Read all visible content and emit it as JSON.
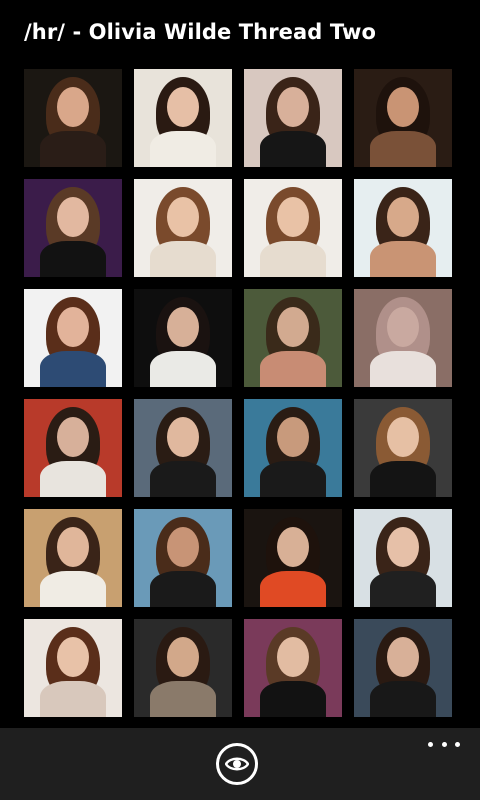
{
  "header": {
    "title": "/hr/ - Olivia Wilde Thread Two"
  },
  "thumbnails": [
    {
      "bg": "#1b1712",
      "hair": "#4a2c1a",
      "skin": "#d9a78a",
      "cloth": "#2a1d17"
    },
    {
      "bg": "#e8e3da",
      "hair": "#2a1a12",
      "skin": "#e6bfa6",
      "cloth": "#f0ece4"
    },
    {
      "bg": "#d8c8c0",
      "hair": "#3a2418",
      "skin": "#d8b09a",
      "cloth": "#161616"
    },
    {
      "bg": "#2a1c14",
      "hair": "#1e120c",
      "skin": "#c99474",
      "cloth": "#7a5138"
    },
    {
      "bg": "#3b1c4a",
      "hair": "#5a3a26",
      "skin": "#e2b8a0",
      "cloth": "#121212"
    },
    {
      "bg": "#f0ede8",
      "hair": "#7a4a2c",
      "skin": "#e9c2a6",
      "cloth": "#e6dccf"
    },
    {
      "bg": "#f0ede8",
      "hair": "#7a4a2c",
      "skin": "#e9c2a6",
      "cloth": "#e6dccf"
    },
    {
      "bg": "#e6eef0",
      "hair": "#3a2418",
      "skin": "#d7a98a",
      "cloth": "#c99474"
    },
    {
      "bg": "#f2f2f2",
      "hair": "#5a2e1a",
      "skin": "#e2b39a",
      "cloth": "#2d4b74"
    },
    {
      "bg": "#0e0e0e",
      "hair": "#1a1210",
      "skin": "#d7b098",
      "cloth": "#eaeae6"
    },
    {
      "bg": "#4c5a3a",
      "hair": "#3a2a1a",
      "skin": "#d2aa90",
      "cloth": "#c88c74"
    },
    {
      "bg": "#8a6e66",
      "hair": "#b0908a",
      "skin": "#c9a9a0",
      "cloth": "#e8e0dc"
    },
    {
      "bg": "#b83a2a",
      "hair": "#2a1c14",
      "skin": "#d7b09a",
      "cloth": "#e8e4de"
    },
    {
      "bg": "#5a6a7a",
      "hair": "#2a1c14",
      "skin": "#e0b89e",
      "cloth": "#1a1a1a"
    },
    {
      "bg": "#3a7a9a",
      "hair": "#2a1c14",
      "skin": "#c89a7c",
      "cloth": "#1a1a1a"
    },
    {
      "bg": "#3a3a3a",
      "hair": "#8a5a34",
      "skin": "#e6c0a4",
      "cloth": "#141414"
    },
    {
      "bg": "#c8a070",
      "hair": "#3a2418",
      "skin": "#e0b69a",
      "cloth": "#f0ece4"
    },
    {
      "bg": "#6a9ab8",
      "hair": "#4a2c1a",
      "skin": "#c89476",
      "cloth": "#1a1a1a"
    },
    {
      "bg": "#1a1410",
      "hair": "#1e120c",
      "skin": "#d8b096",
      "cloth": "#e04a24"
    },
    {
      "bg": "#d8e0e4",
      "hair": "#3a2418",
      "skin": "#e6c0a8",
      "cloth": "#202020"
    },
    {
      "bg": "#ece6e0",
      "hair": "#5a2e1a",
      "skin": "#e8c2a8",
      "cloth": "#d8c8bc"
    },
    {
      "bg": "#2a2a2a",
      "hair": "#2a1a12",
      "skin": "#d2a88a",
      "cloth": "#8a7a6a"
    },
    {
      "bg": "#7a3a5a",
      "hair": "#5a3a26",
      "skin": "#e2bca2",
      "cloth": "#121212"
    },
    {
      "bg": "#3a4a5a",
      "hair": "#2a1a12",
      "skin": "#d8b098",
      "cloth": "#181818"
    }
  ],
  "appbar": {
    "view_icon": "eye-icon",
    "more_icon": "ellipsis-icon"
  }
}
